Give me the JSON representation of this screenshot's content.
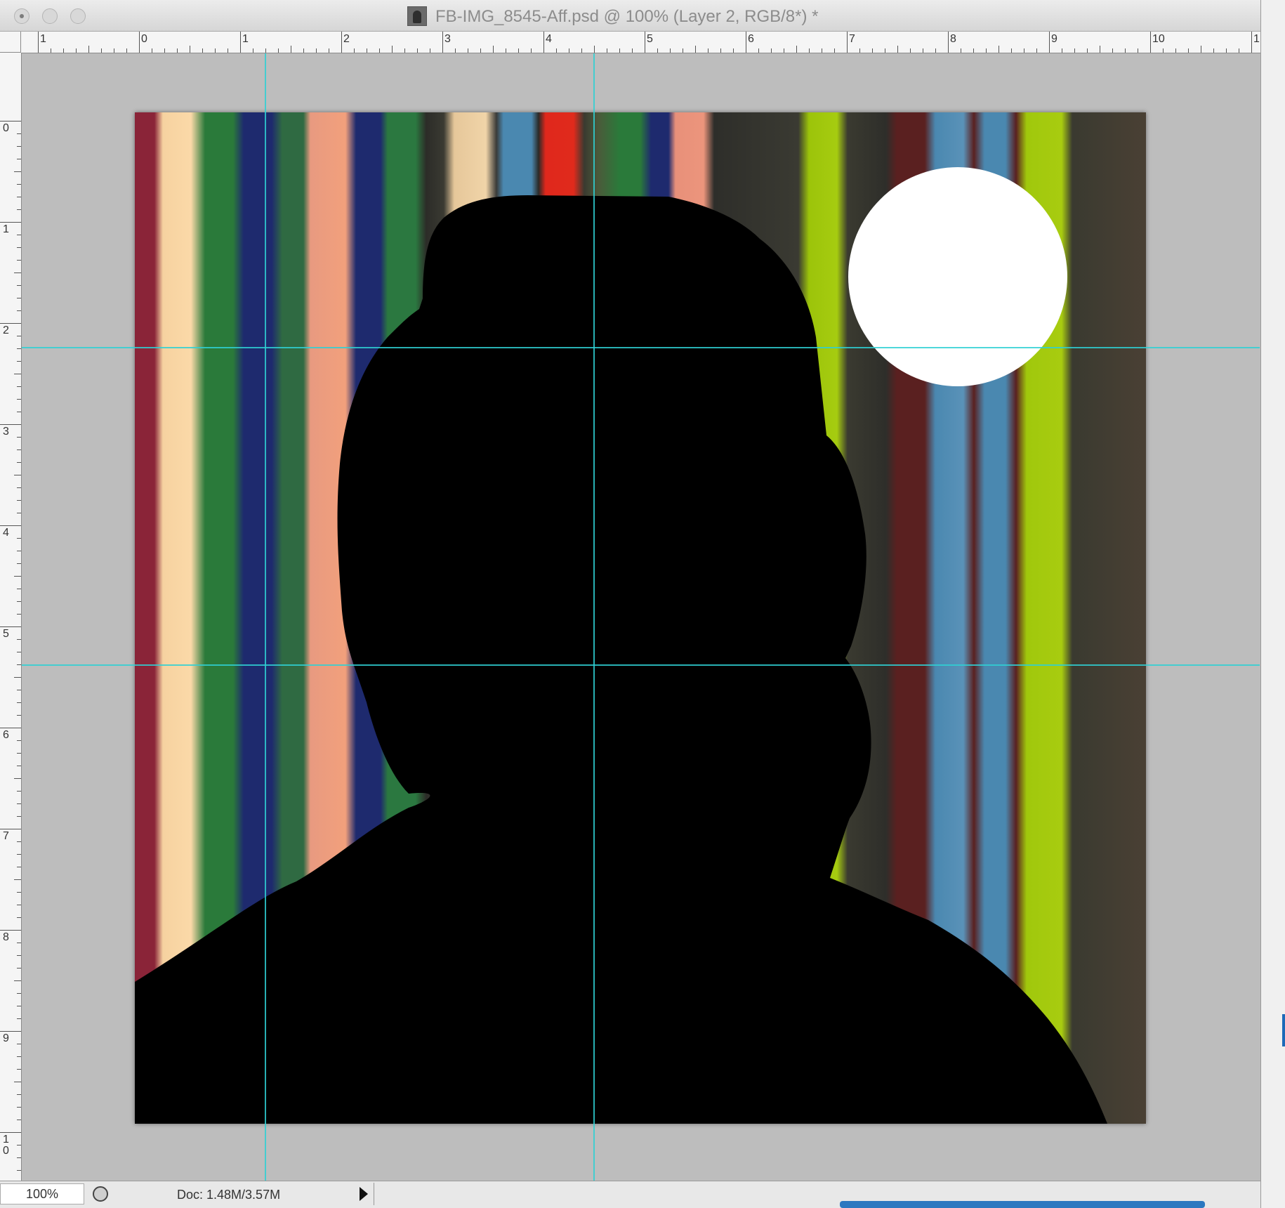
{
  "window": {
    "title": "FB-IMG_8545-Aff.psd @ 100% (Layer 2, RGB/8*) *"
  },
  "rulers": {
    "horizontal_labels": [
      "1",
      "0",
      "1",
      "2",
      "3",
      "4",
      "5",
      "6",
      "7",
      "8",
      "9",
      "10",
      "1"
    ],
    "vertical_labels": [
      "0",
      "1",
      "2",
      "3",
      "4",
      "5",
      "6",
      "7",
      "8",
      "9",
      "1\n0"
    ]
  },
  "statusbar": {
    "zoom": "100%",
    "doc_size": "Doc: 1.48M/3.57M"
  },
  "colors": {
    "guide": "#2fd0d4",
    "pasteboard": "#bdbdbd",
    "silhouette": "#000000",
    "sun": "#ffffff"
  },
  "icons": [
    "close-icon",
    "minimize-icon",
    "zoom-icon",
    "document-thumbnail-icon",
    "info-icon",
    "status-arrow-icon"
  ]
}
